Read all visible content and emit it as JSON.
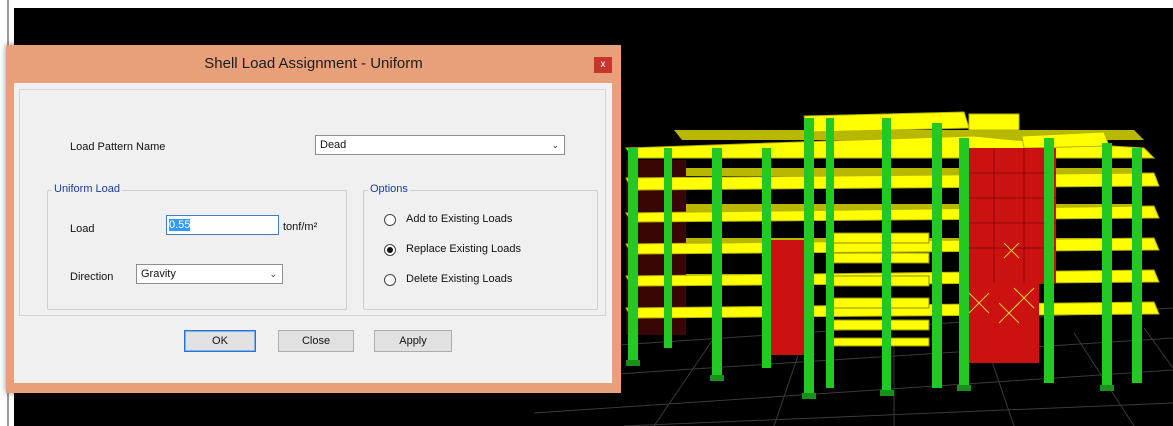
{
  "dialog": {
    "title": "Shell Load Assignment - Uniform",
    "close_glyph": "x",
    "load_pattern": {
      "label": "Load Pattern Name",
      "selected": "Dead"
    },
    "uniform_load": {
      "group_title": "Uniform Load",
      "load_label": "Load",
      "load_value": "0.55",
      "unit": "tonf/m²",
      "direction_label": "Direction",
      "direction_selected": "Gravity"
    },
    "options": {
      "group_title": "Options",
      "items": [
        {
          "label": "Add to Existing Loads",
          "checked": false
        },
        {
          "label": "Replace Existing Loads",
          "checked": true
        },
        {
          "label": "Delete Existing Loads",
          "checked": false
        }
      ]
    },
    "buttons": {
      "ok": "OK",
      "close": "Close",
      "apply": "Apply"
    }
  },
  "colors": {
    "title_bar": "#e8a07a",
    "slab": "#ffff00",
    "column": "#22c922",
    "shell_load": "#cc1111",
    "background": "#000000"
  }
}
